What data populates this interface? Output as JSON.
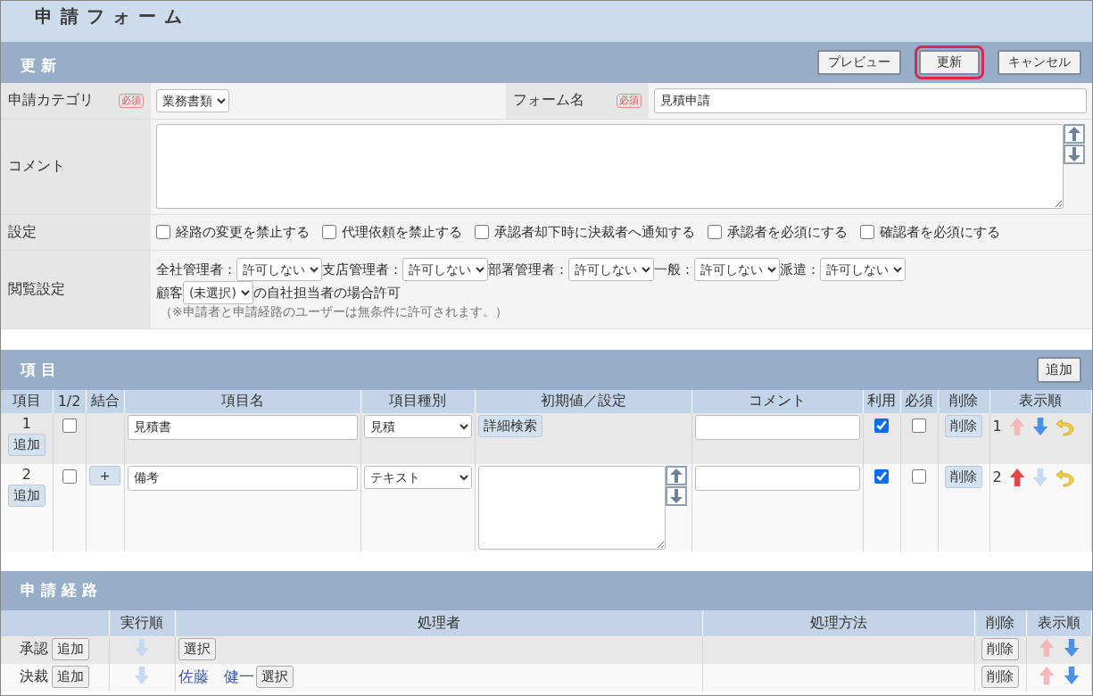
{
  "title": "申請フォーム",
  "edit_section": {
    "heading": "更新",
    "buttons": [
      {
        "label": "プレビュー",
        "highlighted": false
      },
      {
        "label": "更新",
        "highlighted": true
      },
      {
        "label": "キャンセル",
        "highlighted": false
      }
    ],
    "category": {
      "label": "申請カテゴリ",
      "badge": "必須",
      "value": "業務書類"
    },
    "form_name": {
      "label": "フォーム名",
      "badge": "必須",
      "value": "見積申請"
    },
    "comment": {
      "label": "コメント"
    },
    "settings": {
      "label": "設定",
      "options": [
        {
          "label": "経路の変更を禁止する",
          "checked": false
        },
        {
          "label": "代理依頼を禁止する",
          "checked": false
        },
        {
          "label": "承認者却下時に決裁者へ通知する",
          "checked": false
        },
        {
          "label": "承認者を必須にする",
          "checked": false
        },
        {
          "label": "確認者を必須にする",
          "checked": false
        }
      ]
    },
    "view_settings": {
      "label": "閲覧設定",
      "roles": [
        {
          "label": "全社管理者：",
          "value": "許可しない"
        },
        {
          "label": "支店管理者：",
          "value": "許可しない"
        },
        {
          "label": "部署管理者：",
          "value": "許可しない"
        },
        {
          "label": "一般：",
          "value": "許可しない"
        },
        {
          "label": "派遣：",
          "value": "許可しない"
        }
      ],
      "customer": {
        "prefix": "顧客",
        "value": "(未選択)",
        "suffix": "の自社担当者の場合許可"
      },
      "note": "（※申請者と申請経路のユーザーは無条件に許可されます。）"
    }
  },
  "items_section": {
    "heading": "項目",
    "add_button": "追加",
    "columns": [
      "項目",
      "1/2",
      "結合",
      "項目名",
      "項目種別",
      "初期値／設定",
      "コメント",
      "利用",
      "必須",
      "削除",
      "表示順"
    ],
    "rows": [
      {
        "number": "1",
        "add": "追加",
        "half": false,
        "name": "見積書",
        "type": "見積",
        "setting": {
          "kind": "button",
          "label": "詳細検索"
        },
        "use": true,
        "required": false,
        "delete": "削除",
        "order": "1",
        "up_enabled": false,
        "down_enabled": true
      },
      {
        "number": "2",
        "add": "追加",
        "half": false,
        "join": "+",
        "name": "備考",
        "type": "テキスト",
        "setting": {
          "kind": "textarea"
        },
        "use": true,
        "required": false,
        "delete": "削除",
        "order": "2",
        "up_enabled": true,
        "down_enabled": false
      }
    ]
  },
  "route_section": {
    "heading": "申請経路",
    "columns": [
      "実行順",
      "処理者",
      "処理方法",
      "削除",
      "表示順"
    ],
    "rows": [
      {
        "label": "承認",
        "add": "追加",
        "exec_down_enabled": false,
        "select": "選択",
        "delete": "削除",
        "up_enabled": false,
        "down_enabled": true
      },
      {
        "label": "決裁",
        "add": "追加",
        "exec_down_enabled": false,
        "processor": "佐藤　健一",
        "select": "選択",
        "delete": "削除",
        "up_enabled": false,
        "down_enabled": true
      }
    ]
  }
}
